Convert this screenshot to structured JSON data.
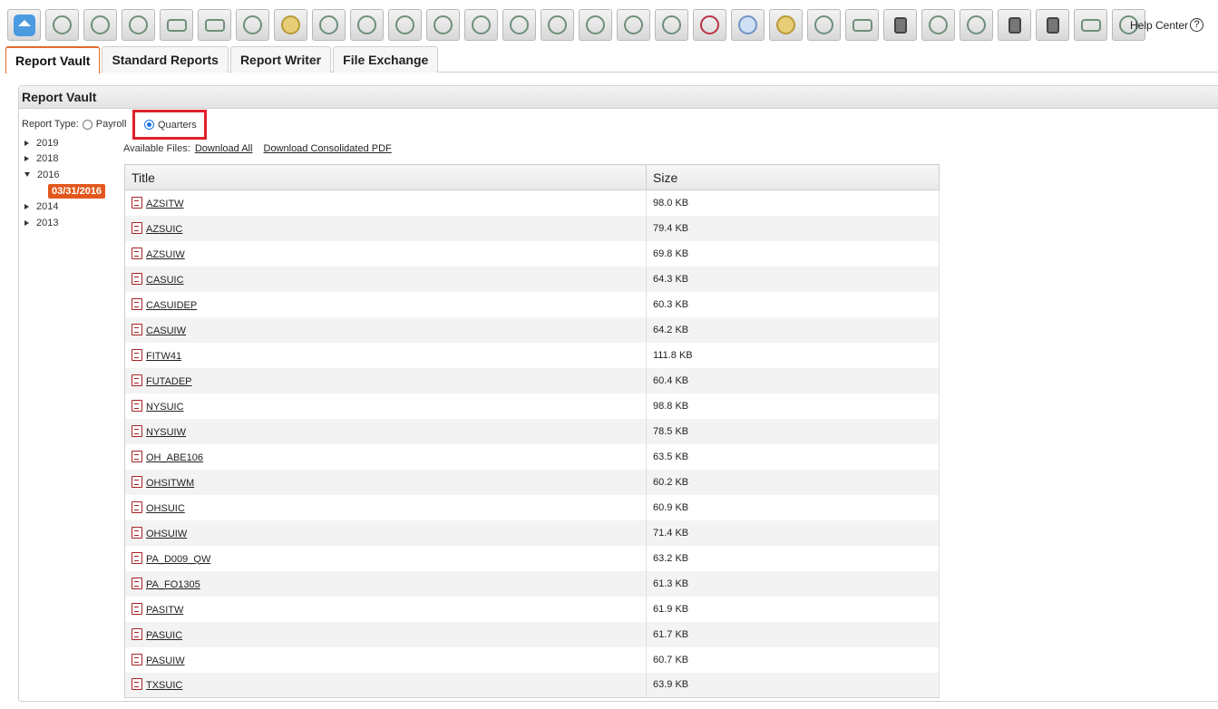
{
  "toolbar": {
    "icons": [
      "home-icon",
      "award-icon",
      "coins-gear-icon",
      "money-tree-icon",
      "team-icon",
      "org-chart-icon",
      "document-edit-icon",
      "money-bag-icon",
      "person-search-icon",
      "target-gear-icon",
      "target-icon",
      "growth-chart-icon",
      "target-settings-icon",
      "person-money-icon",
      "person-star-icon",
      "shield-person-icon",
      "award-person-icon",
      "person-money-down-icon",
      "person-remove-icon",
      "fingerprint-icon",
      "money-bag-2-icon",
      "person-star-2-icon",
      "team-board-icon",
      "clipboard-icon",
      "shield-person-2-icon",
      "person-search-2-icon",
      "gift-icon",
      "document-icon",
      "team-meeting-icon",
      "certificate-icon"
    ],
    "help_label": "Help Center",
    "help_icon": "?"
  },
  "tabs": [
    {
      "label": "Report Vault",
      "active": true
    },
    {
      "label": "Standard Reports",
      "active": false
    },
    {
      "label": "Report Writer",
      "active": false
    },
    {
      "label": "File Exchange",
      "active": false
    }
  ],
  "panel": {
    "title": "Report Vault",
    "report_type_label": "Report Type:",
    "option_payroll": "Payroll",
    "option_quarters": "Quarters",
    "selected": "Quarters"
  },
  "tree": {
    "years": [
      {
        "label": "2019",
        "expanded": false
      },
      {
        "label": "2018",
        "expanded": false
      },
      {
        "label": "2016",
        "expanded": true,
        "children": [
          "03/31/2016"
        ]
      },
      {
        "label": "2014",
        "expanded": false
      },
      {
        "label": "2013",
        "expanded": false
      }
    ]
  },
  "files": {
    "available_label": "Available Files:",
    "download_all": "Download All",
    "download_pdf": "Download Consolidated PDF",
    "columns": [
      "Title",
      "Size"
    ],
    "rows": [
      {
        "title": "AZSITW",
        "size": "98.0 KB"
      },
      {
        "title": "AZSUIC",
        "size": "79.4 KB"
      },
      {
        "title": "AZSUIW",
        "size": "69.8 KB"
      },
      {
        "title": "CASUIC",
        "size": "64.3 KB"
      },
      {
        "title": "CASUIDEP",
        "size": "60.3 KB"
      },
      {
        "title": "CASUIW",
        "size": "64.2 KB"
      },
      {
        "title": "FITW41",
        "size": "111.8 KB"
      },
      {
        "title": "FUTADEP",
        "size": "60.4 KB"
      },
      {
        "title": "NYSUIC",
        "size": "98.8 KB"
      },
      {
        "title": "NYSUIW",
        "size": "78.5 KB"
      },
      {
        "title": "OH_ABE106",
        "size": "63.5 KB"
      },
      {
        "title": "OHSITWM",
        "size": "60.2 KB"
      },
      {
        "title": "OHSUIC",
        "size": "60.9 KB"
      },
      {
        "title": "OHSUIW",
        "size": "71.4 KB"
      },
      {
        "title": "PA_D009_QW",
        "size": "63.2 KB"
      },
      {
        "title": "PA_FO1305",
        "size": "61.3 KB"
      },
      {
        "title": "PASITW",
        "size": "61.9 KB"
      },
      {
        "title": "PASUIC",
        "size": "61.7 KB"
      },
      {
        "title": "PASUIW",
        "size": "60.7 KB"
      },
      {
        "title": "TXSUIC",
        "size": "63.9 KB"
      }
    ]
  },
  "colors": {
    "accent": "#e2581c",
    "highlight": "#e0212b",
    "radio": "#1a73e8"
  }
}
